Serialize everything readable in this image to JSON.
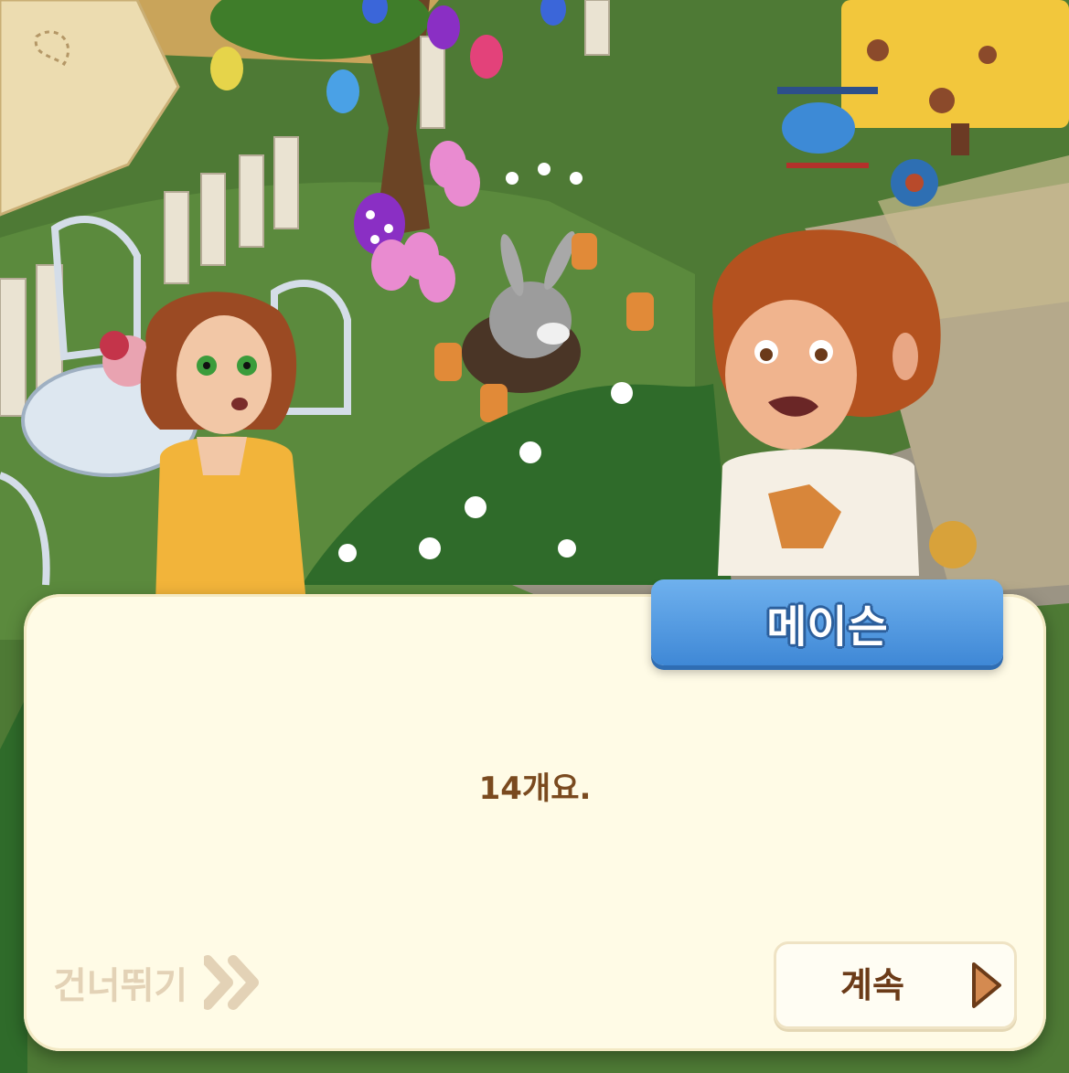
{
  "dialog": {
    "speaker_name": "메이슨",
    "message": "14개요.",
    "skip_label": "건너뛰기",
    "continue_label": "계속"
  },
  "colors": {
    "dialog_bg": "#fffbe6",
    "nameplate_blue": "#4a90dc",
    "message_text": "#7a4a1f",
    "skip_text": "#e3d2b6",
    "continue_arrow": "#d48a50"
  },
  "icons": {
    "skip": "double-chevron-right-icon",
    "continue": "play-arrow-icon"
  }
}
